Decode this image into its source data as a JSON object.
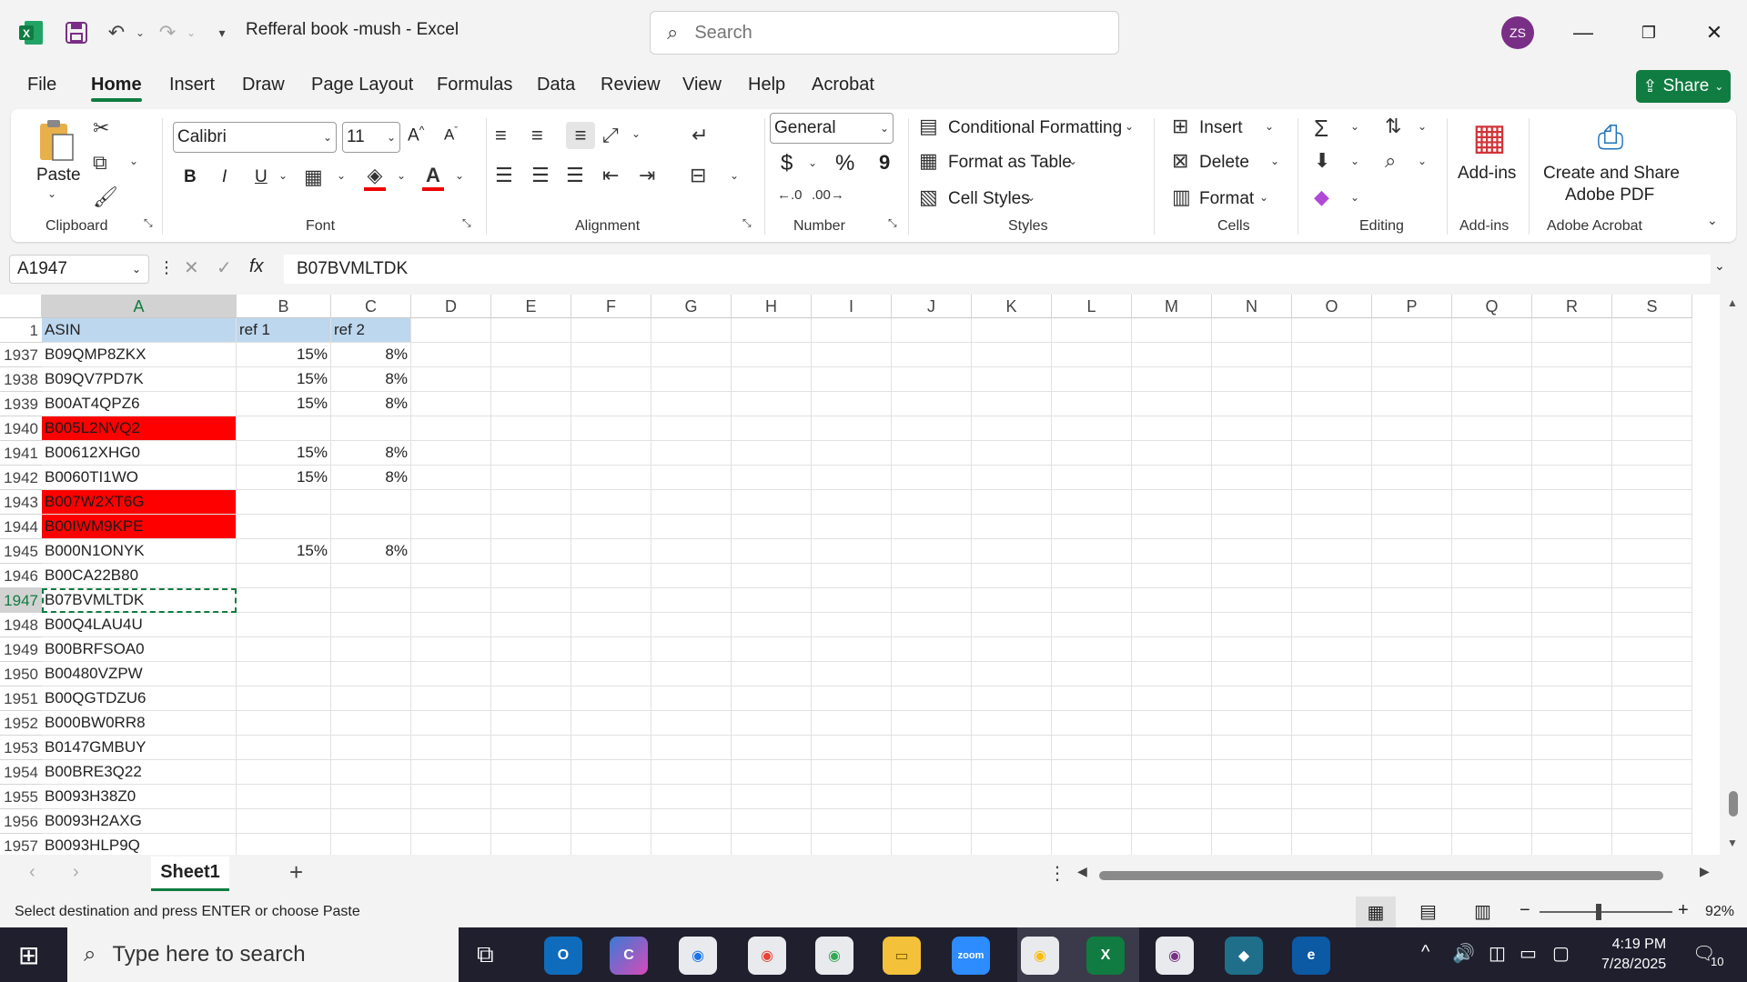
{
  "window": {
    "title": "Refferal book -mush  -  Excel",
    "avatar_initials": "ZS"
  },
  "search": {
    "placeholder": "Search"
  },
  "menu": {
    "tabs": [
      "File",
      "Home",
      "Insert",
      "Draw",
      "Page Layout",
      "Formulas",
      "Data",
      "Review",
      "View",
      "Help",
      "Acrobat"
    ],
    "active": "Home",
    "share_label": "Share"
  },
  "ribbon": {
    "clipboard": {
      "paste_label": "Paste",
      "group_label": "Clipboard"
    },
    "font": {
      "font_name": "Calibri",
      "font_size": "11",
      "group_label": "Font",
      "bold": "B",
      "italic": "I",
      "underline": "U"
    },
    "alignment": {
      "group_label": "Alignment"
    },
    "number": {
      "format": "General",
      "group_label": "Number",
      "currency": "$",
      "percent": "%",
      "comma": "9"
    },
    "styles": {
      "conditional_formatting": "Conditional Formatting",
      "format_as_table": "Format as Table",
      "cell_styles": "Cell Styles",
      "group_label": "Styles"
    },
    "cells": {
      "insert": "Insert",
      "delete": "Delete",
      "format": "Format",
      "group_label": "Cells"
    },
    "editing": {
      "group_label": "Editing"
    },
    "addins": {
      "label": "Add-ins",
      "group_label": "Add-ins"
    },
    "acrobat": {
      "label_line1": "Create and Share",
      "label_line2": "Adobe PDF",
      "group_label": "Adobe Acrobat"
    }
  },
  "formula_bar": {
    "name_box": "A1947",
    "fx": "fx",
    "value": "B07BVMLTDK"
  },
  "grid": {
    "columns": [
      "A",
      "B",
      "C",
      "D",
      "E",
      "F",
      "G",
      "H",
      "I",
      "J",
      "K",
      "L",
      "M",
      "N",
      "O",
      "P",
      "Q",
      "R",
      "S"
    ],
    "header_row": {
      "row": "1",
      "a": "ASIN",
      "b": "ref 1",
      "c": "ref 2"
    },
    "rows": [
      {
        "row": "1937",
        "a": "B09QMP8ZKX",
        "b": "15%",
        "c": "8%",
        "red": false
      },
      {
        "row": "1938",
        "a": "B09QV7PD7K",
        "b": "15%",
        "c": "8%",
        "red": false
      },
      {
        "row": "1939",
        "a": "B00AT4QPZ6",
        "b": "15%",
        "c": "8%",
        "red": false
      },
      {
        "row": "1940",
        "a": "B005L2NVQ2",
        "b": "",
        "c": "",
        "red": true
      },
      {
        "row": "1941",
        "a": "B00612XHG0",
        "b": "15%",
        "c": "8%",
        "red": false
      },
      {
        "row": "1942",
        "a": "B0060TI1WO",
        "b": "15%",
        "c": "8%",
        "red": false
      },
      {
        "row": "1943",
        "a": "B007W2XT6G",
        "b": "",
        "c": "",
        "red": true
      },
      {
        "row": "1944",
        "a": "B00IWM9KPE",
        "b": "",
        "c": "",
        "red": true
      },
      {
        "row": "1945",
        "a": "B000N1ONYK",
        "b": "15%",
        "c": "8%",
        "red": false
      },
      {
        "row": "1946",
        "a": "B00CA22B80",
        "b": "",
        "c": "",
        "red": false
      },
      {
        "row": "1947",
        "a": "B07BVMLTDK",
        "b": "",
        "c": "",
        "red": false
      },
      {
        "row": "1948",
        "a": "B00Q4LAU4U",
        "b": "",
        "c": "",
        "red": false
      },
      {
        "row": "1949",
        "a": "B00BRFSOA0",
        "b": "",
        "c": "",
        "red": false
      },
      {
        "row": "1950",
        "a": "B00480VZPW",
        "b": "",
        "c": "",
        "red": false
      },
      {
        "row": "1951",
        "a": "B00QGTDZU6",
        "b": "",
        "c": "",
        "red": false
      },
      {
        "row": "1952",
        "a": "B000BW0RR8",
        "b": "",
        "c": "",
        "red": false
      },
      {
        "row": "1953",
        "a": "B0147GMBUY",
        "b": "",
        "c": "",
        "red": false
      },
      {
        "row": "1954",
        "a": "B00BRE3Q22",
        "b": "",
        "c": "",
        "red": false
      },
      {
        "row": "1955",
        "a": "B0093H38Z0",
        "b": "",
        "c": "",
        "red": false
      },
      {
        "row": "1956",
        "a": "B0093H2AXG",
        "b": "",
        "c": "",
        "red": false
      },
      {
        "row": "1957",
        "a": "B0093HLP9Q",
        "b": "",
        "c": "",
        "red": false
      }
    ],
    "selected_row": "1947"
  },
  "sheets": {
    "active": "Sheet1"
  },
  "status": {
    "message": "Select destination and press ENTER or choose Paste",
    "zoom": "92%"
  },
  "taskbar": {
    "search_placeholder": "Type here to search",
    "time": "4:19 PM",
    "date": "7/28/2025",
    "notifications": "10"
  },
  "colors": {
    "excel_green": "#107c41",
    "header_fill": "#bdd7ee",
    "red_fill": "#ff0000"
  }
}
